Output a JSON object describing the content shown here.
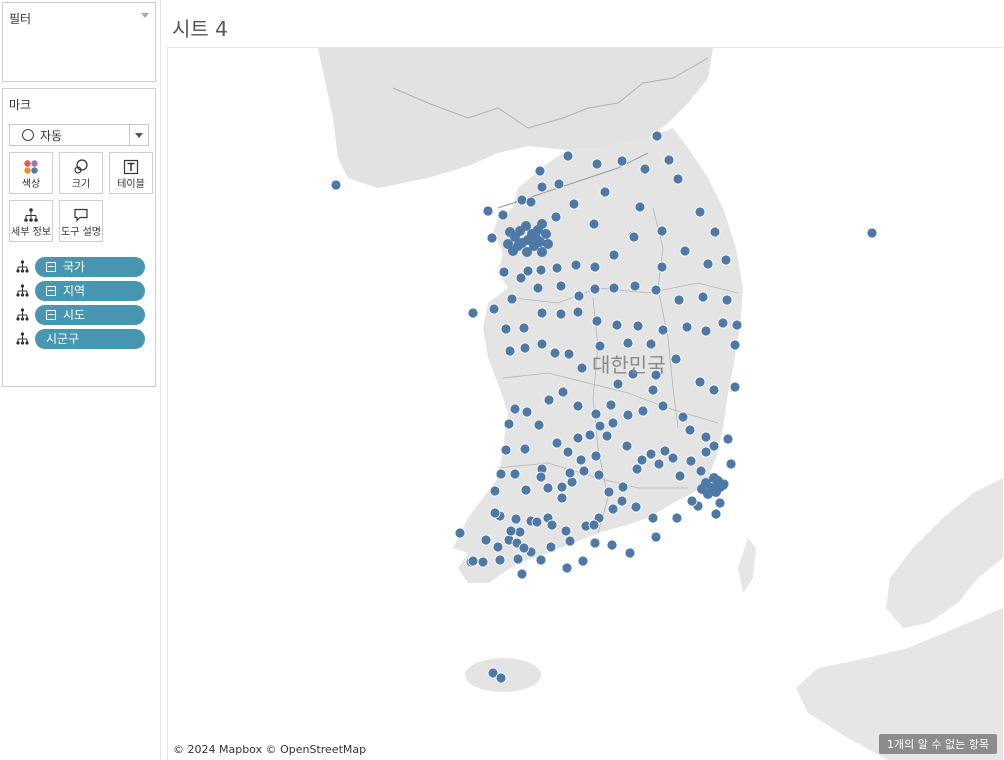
{
  "sheet_title": "시트 4",
  "filters": {
    "title": "필터"
  },
  "marks": {
    "title": "마크",
    "mark_type": "자동",
    "buttons": [
      {
        "name": "color",
        "label": "색상",
        "icon": "color-icon"
      },
      {
        "name": "size",
        "label": "크기",
        "icon": "size-icon"
      },
      {
        "name": "label",
        "label": "테이블",
        "icon": "text-icon"
      },
      {
        "name": "detail",
        "label": "세부 정보",
        "icon": "detail-icon"
      },
      {
        "name": "tooltip",
        "label": "도구 설명",
        "icon": "tooltip-icon"
      }
    ],
    "pills": [
      {
        "label": "국가",
        "collapse": true
      },
      {
        "label": "지역",
        "collapse": true
      },
      {
        "label": "시도",
        "collapse": true
      },
      {
        "label": "시군구",
        "collapse": false
      }
    ]
  },
  "map": {
    "country_label": "대한민국",
    "attribution": "© 2024 Mapbox © OpenStreetMap",
    "unknown_items": "1개의 알 수 없는 항목",
    "mark_color": "#4e79a7",
    "land_color": "#e4e4e4",
    "water_color": "#ffffff"
  }
}
